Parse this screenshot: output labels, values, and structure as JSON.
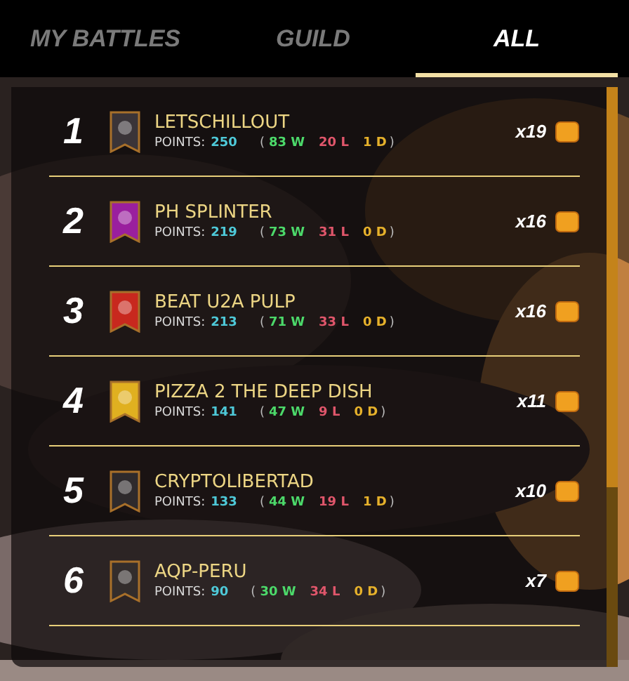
{
  "tabs": [
    {
      "label": "MY BATTLES",
      "selected": false
    },
    {
      "label": "GUILD",
      "selected": false
    },
    {
      "label": "ALL",
      "selected": true
    }
  ],
  "rows": [
    {
      "rank": "1",
      "color": "#3a3438",
      "name": "LETSCHILLOUT",
      "points_label": "POINTS:",
      "points": "250",
      "stats": {
        "open": "(",
        "wins": "83 W",
        "losses": "20 L",
        "draws": "1 D",
        "close": ")"
      },
      "multiplier": "x19"
    },
    {
      "rank": "2",
      "color": "#9a1f9e",
      "name": "PH SPLINTER",
      "points_label": "POINTS:",
      "points": "219",
      "stats": {
        "open": "(",
        "wins": "73 W",
        "losses": "31 L",
        "draws": "0 D",
        "close": ")"
      },
      "multiplier": "x16"
    },
    {
      "rank": "3",
      "color": "#c8281e",
      "name": "BEAT U2A PULP",
      "points_label": "POINTS:",
      "points": "213",
      "stats": {
        "open": "(",
        "wins": "71 W",
        "losses": "33 L",
        "draws": "0 D",
        "close": ")"
      },
      "multiplier": "x16"
    },
    {
      "rank": "4",
      "color": "#e0b020",
      "name": "PIZZA 2 THE DEEP DISH",
      "points_label": "POINTS:",
      "points": "141",
      "stats": {
        "open": "(",
        "wins": "47 W",
        "losses": "9 L",
        "draws": "0 D",
        "close": ")"
      },
      "multiplier": "x11"
    },
    {
      "rank": "5",
      "color": "#2e2a2c",
      "name": "CRYPTOLIBERTAD",
      "points_label": "POINTS:",
      "points": "133",
      "stats": {
        "open": "(",
        "wins": "44 W",
        "losses": "19 L",
        "draws": "1 D",
        "close": ")"
      },
      "multiplier": "x10"
    },
    {
      "rank": "6",
      "color": "#332d2c",
      "name": "AQP-PERU",
      "points_label": "POINTS:",
      "points": "90",
      "stats": {
        "open": "(",
        "wins": "30 W",
        "losses": "34 L",
        "draws": "0 D",
        "close": ")"
      },
      "multiplier": "x7"
    }
  ]
}
